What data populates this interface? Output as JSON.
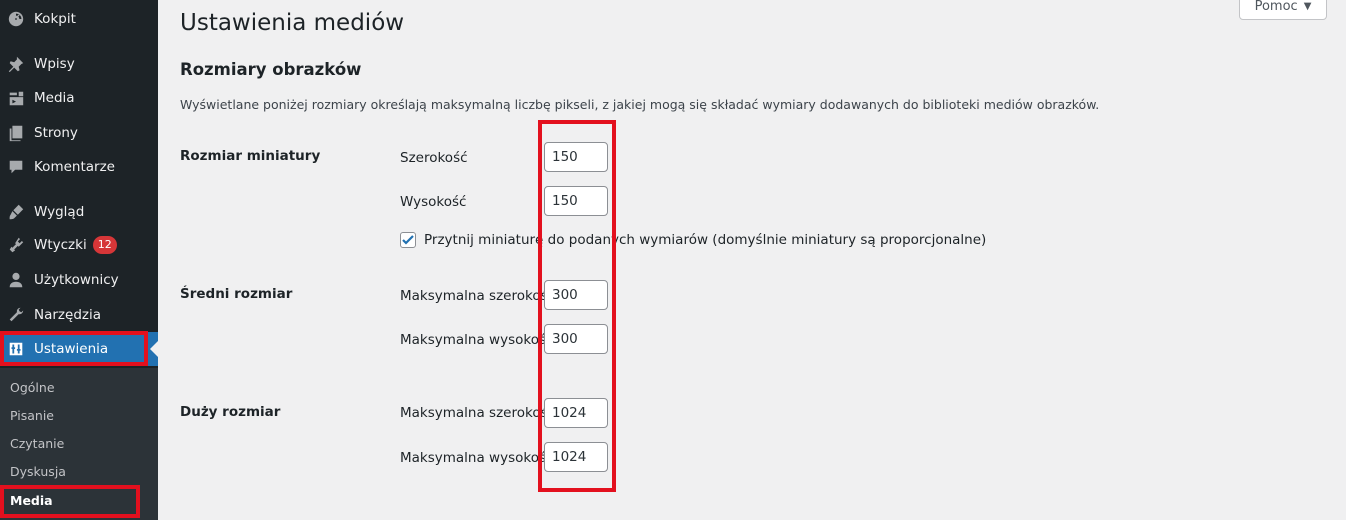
{
  "sidebar": {
    "items": [
      {
        "label": "Kokpit",
        "icon": "dashboard-icon"
      },
      {
        "label": "Wpisy",
        "icon": "pin-icon"
      },
      {
        "label": "Media",
        "icon": "media-icon"
      },
      {
        "label": "Strony",
        "icon": "pages-icon"
      },
      {
        "label": "Komentarze",
        "icon": "comment-icon"
      },
      {
        "label": "Wygląd",
        "icon": "appearance-icon"
      },
      {
        "label": "Wtyczki",
        "icon": "plugins-icon",
        "badge": "12"
      },
      {
        "label": "Użytkownicy",
        "icon": "users-icon"
      },
      {
        "label": "Narzędzia",
        "icon": "tools-icon"
      },
      {
        "label": "Ustawienia",
        "icon": "settings-icon",
        "active": true
      }
    ],
    "submenu": [
      {
        "label": "Ogólne"
      },
      {
        "label": "Pisanie"
      },
      {
        "label": "Czytanie"
      },
      {
        "label": "Dyskusja"
      },
      {
        "label": "Media",
        "current": true
      }
    ]
  },
  "header": {
    "help_label": "Pomoc"
  },
  "page": {
    "title": "Ustawienia mediów",
    "section_title": "Rozmiary obrazków",
    "description": "Wyświetlane poniżej rozmiary określają maksymalną liczbę pikseli, z jakiej mogą się składać wymiary dodawanych do biblioteki mediów obrazków."
  },
  "thumbnail": {
    "heading": "Rozmiar miniatury",
    "width_label": "Szerokość",
    "width_value": "150",
    "height_label": "Wysokość",
    "height_value": "150",
    "crop_label": "Przytnij miniaturę do podanych wymiarów (domyślnie miniatury są proporcjonalne)",
    "crop_checked": true
  },
  "medium": {
    "heading": "Średni rozmiar",
    "width_label": "Maksymalna szerokość",
    "width_value": "300",
    "height_label": "Maksymalna wysokość",
    "height_value": "300"
  },
  "large": {
    "heading": "Duży rozmiar",
    "width_label": "Maksymalna szerokość",
    "width_value": "1024",
    "height_label": "Maksymalna wysokość",
    "height_value": "1024"
  },
  "colors": {
    "sidebar_bg": "#1d2327",
    "submenu_bg": "#2c3338",
    "accent": "#2271b1",
    "badge": "#d63638",
    "highlight": "#e3101e"
  }
}
